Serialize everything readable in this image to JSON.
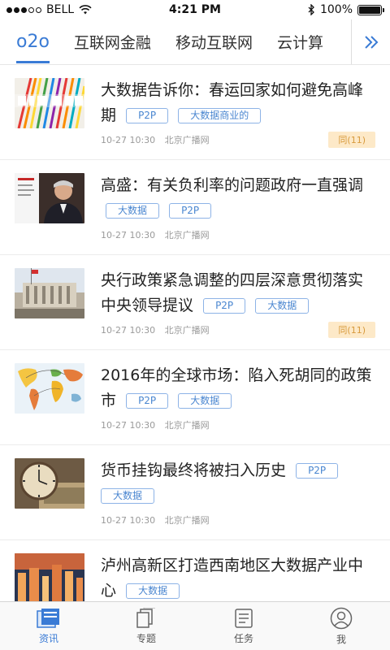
{
  "status_bar": {
    "carrier": "BELL",
    "time": "4:21 PM",
    "battery": "100%",
    "icons": [
      "signal-dots-icon",
      "wifi-icon",
      "bluetooth-icon",
      "battery-icon"
    ]
  },
  "tabs": {
    "items": [
      "o2o",
      "互联网金融",
      "移动互联网",
      "云计算"
    ],
    "active_index": 0,
    "more_icon": "double-chevron-right-icon",
    "accent": "#3a7bd5"
  },
  "articles": [
    {
      "title": "大数据告诉你：春运回家如何避免高峰期",
      "tags": [
        "P2P",
        "大数据商业的"
      ],
      "time": "10-27 10:30",
      "source": "北京广播网",
      "badge": "同(11)",
      "thumb": "big-data-thumb"
    },
    {
      "title": "高盛：有关负利率的问题政府一直强调",
      "tags": [
        "大数据",
        "P2P"
      ],
      "time": "10-27 10:30",
      "source": "北京广播网",
      "badge": "",
      "thumb": "speaker-thumb"
    },
    {
      "title": "央行政策紧急调整的四层深意贯彻落实中央领导提议",
      "tags": [
        "P2P",
        "大数据"
      ],
      "time": "10-27 10:30",
      "source": "北京广播网",
      "badge": "同(11)",
      "thumb": "central-bank-thumb"
    },
    {
      "title": "2016年的全球市场：陷入死胡同的政策市",
      "tags": [
        "P2P",
        "大数据"
      ],
      "time": "10-27 10:30",
      "source": "北京广播网",
      "badge": "",
      "thumb": "world-map-thumb"
    },
    {
      "title": "货币挂钩最终将被扫入历史",
      "tags": [
        "P2P",
        "大数据"
      ],
      "time": "10-27 10:30",
      "source": "北京广播网",
      "badge": "",
      "thumb": "clock-money-thumb"
    },
    {
      "title": "泸州高新区打造西南地区大数据产业中心",
      "tags": [
        "大数据"
      ],
      "time": "",
      "source": "",
      "badge": "",
      "thumb": "city-thumb"
    }
  ],
  "bottom_nav": {
    "items": [
      {
        "label": "资讯",
        "icon": "news-icon"
      },
      {
        "label": "专题",
        "icon": "topics-icon"
      },
      {
        "label": "任务",
        "icon": "tasks-icon"
      },
      {
        "label": "我",
        "icon": "profile-icon"
      }
    ],
    "active_index": 0
  }
}
